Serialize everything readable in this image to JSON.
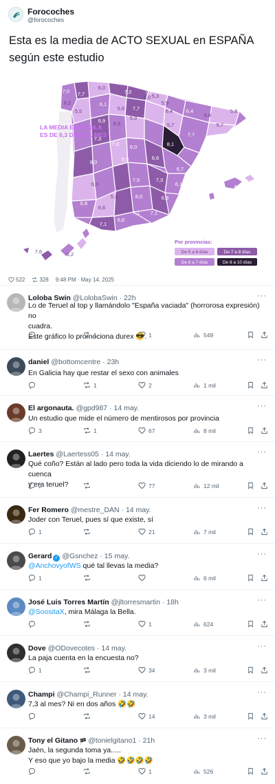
{
  "post": {
    "author_name": "Forocoches",
    "author_handle": "@forocoches",
    "text": "Esta es la media de ACTO SEXUAL en ESPAÑA según este estudio",
    "likes": "522",
    "reposts": "328",
    "timestamp": "9:48 PM · May 14, 2025"
  },
  "map": {
    "headline_line1": "LA MEDIA ESPAÑOLA",
    "headline_line2": "ES DE 6,3 DÍAS AL MES",
    "legend_title": "Por provincias:",
    "legend": [
      {
        "label": "De 5 a 6 días",
        "color": "#dcb4ec",
        "text_color": "#6b3f86"
      },
      {
        "label": "De 7 a 8 días",
        "color": "#8e5ba8",
        "text_color": "#ffffff"
      },
      {
        "label": "De 6 a 7 días",
        "color": "#b37fd0",
        "text_color": "#ffffff"
      },
      {
        "label": "De 8 a 10 días",
        "color": "#2a1d35",
        "text_color": "#ffffff"
      }
    ],
    "values": [
      "7,0",
      "7,7",
      "6,0",
      "7,3",
      "7,1",
      "6,0",
      "5,3",
      "5,9",
      "6,4",
      "5,8",
      "5,8",
      "6,2",
      "6,1",
      "5,6",
      "7,7",
      "6,4",
      "5,5",
      "6,9",
      "6,5",
      "5,9",
      "5,7",
      "5,7",
      "7,3",
      "7,8",
      "6,0",
      "8,1",
      "7,7",
      "8,0",
      "5,9",
      "6,8",
      "6,7",
      "6,0",
      "7,9",
      "7,3",
      "6,1",
      "6,7",
      "5,3",
      "8,0",
      "6,8",
      "6,8",
      "6,6",
      "7,1",
      "7,1",
      "7,1",
      "6,6",
      "7,6",
      "6,2"
    ]
  },
  "replies": [
    {
      "name": "Loloba Swin",
      "handle": "@LolobaSwin",
      "time": "· 22h",
      "lines": [
        "Lo de Teruel al top y llamándolo \"España vaciada\" (horrorosa expresión) no",
        "cuadra.",
        "Este gráfico lo promociona durex 😎."
      ],
      "comments": "",
      "reposts": "1",
      "likes": "1",
      "views": "549"
    },
    {
      "name": "daniel",
      "handle": "@bottomcentre",
      "time": "· 23h",
      "lines": [
        "En Galicia hay que restar el sexo con animales"
      ],
      "comments": "",
      "reposts": "1",
      "likes": "2",
      "views": "1 mil"
    },
    {
      "name": "El argonauta.",
      "handle": "@gpd987",
      "time": "· 14 may.",
      "lines": [
        "Un estudio que mide el número de mentirosos por provincia"
      ],
      "comments": "3",
      "reposts": "1",
      "likes": "67",
      "views": "8 mil"
    },
    {
      "name": "Laertes",
      "handle": "@Laertess05",
      "time": "· 14 may.",
      "lines": [
        "Qué coño? Están al lado pero toda la vida diciendo lo de mirando a cuenca",
        "y era teruel?"
      ],
      "comments": "2",
      "reposts": "",
      "likes": "77",
      "views": "12 mil"
    },
    {
      "name": "Fer Romero",
      "handle": "@mestre_DAN",
      "time": "· 14 may.",
      "lines": [
        "Joder con Teruel, pues sí que existe, sí"
      ],
      "comments": "1",
      "reposts": "",
      "likes": "21",
      "views": "7 mil"
    },
    {
      "name": "Gerard",
      "handle": "@Gsnchez",
      "time": "· 15 may.",
      "mention": "@AnchovyofWS",
      "lines": [
        " qué tal llevas la media?"
      ],
      "comments": "1",
      "reposts": "",
      "likes": "",
      "views": "6 mil",
      "verified": "✓"
    },
    {
      "name": "José Luis Torres Martín",
      "handle": "@jltorresmartin",
      "time": "· 18h",
      "mention": "@SoositaX",
      "lines": [
        ", mira Málaga la Bella."
      ],
      "comments": "",
      "reposts": "",
      "likes": "1",
      "views": "624"
    },
    {
      "name": "Dove",
      "handle": "@ODovecotes",
      "time": "· 14 may.",
      "lines": [
        "La paja cuenta en la encuesta no?"
      ],
      "comments": "1",
      "reposts": "",
      "likes": "34",
      "views": "3 mil"
    },
    {
      "name": "Champi",
      "handle": "@Champi_Runner",
      "time": "· 14 may.",
      "lines": [
        "7,3 al mes? Ni en dos años 🤣🤣"
      ],
      "comments": "",
      "reposts": "",
      "likes": "14",
      "views": "3 mil"
    },
    {
      "name": "Tony el Gitano",
      "handle": "@tonielgitano1",
      "time": "· 21h",
      "lines": [
        "Jaén, la segunda toma ya.....",
        "Y eso que yo bajo la media 🤣🤣🤣🤣"
      ],
      "comments": "",
      "reposts": "",
      "likes": "1",
      "views": "526",
      "verified": "🏴"
    }
  ],
  "colors": {
    "accent": "#1d9bf0",
    "muted": "#536471",
    "text": "#0f1419",
    "divider": "#eff3f4"
  },
  "icons": [
    "reply-icon",
    "repost-icon",
    "like-icon",
    "views-icon",
    "bookmark-icon",
    "share-icon",
    "more-icon"
  ]
}
